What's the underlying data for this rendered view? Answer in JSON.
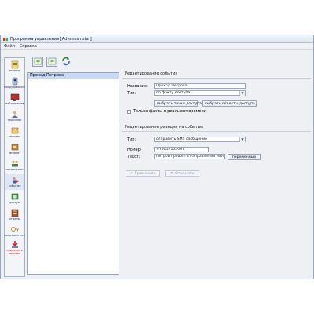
{
  "window": {
    "title": "Программа управления [Advanesh:star]"
  },
  "menu": {
    "file": "Файл",
    "help": "Справка"
  },
  "sidebar": {
    "items": [
      {
        "label": "отчеты",
        "icon": "report-icon"
      },
      {
        "label": "оборудование",
        "icon": "equipment-icon"
      },
      {
        "label": "наблюдение",
        "icon": "monitor-icon"
      },
      {
        "label": "персонал",
        "icon": "personnel-icon"
      },
      {
        "label": "режимы",
        "icon": "modes-icon"
      },
      {
        "label": "автомат",
        "icon": "automat-icon"
      },
      {
        "label": "посетители",
        "icon": "visitors-icon"
      },
      {
        "label": "события",
        "icon": "events-icon"
      },
      {
        "label": "доступ",
        "icon": "access-icon"
      },
      {
        "label": "отделы",
        "icon": "departments-icon"
      },
      {
        "label": "пользователи",
        "icon": "users-icon"
      },
      {
        "label": "применить режимы",
        "icon": "apply-icon"
      }
    ]
  },
  "toolbar": {
    "add": "add-icon",
    "remove": "remove-icon",
    "refresh": "refresh-icon"
  },
  "events": [
    "Проход Петрова"
  ],
  "edit_event": {
    "section_title": "Редактирование события",
    "name_label": "Название:",
    "name_value": "Проход Петрова",
    "type_label": "Тип:",
    "type_value": "по факту доступа",
    "select_points_button": "выбрать точки доступа",
    "select_objects_button": "выбрать объекты доступа",
    "realtime_only_label": "Только факты в реальном времени"
  },
  "edit_reaction": {
    "section_title": "Редактирование реакции на событие",
    "type_label": "Тип:",
    "type_value": "отправить SMS сообщение",
    "number_label": "Номер:",
    "number_value": "+79014155067",
    "text_label": "Текст:",
    "text_value": "Петров прошел в направлении %DIRECTION%",
    "variables_button": "переменные"
  },
  "actions": {
    "apply": "Применить",
    "cancel": "Отменить"
  }
}
